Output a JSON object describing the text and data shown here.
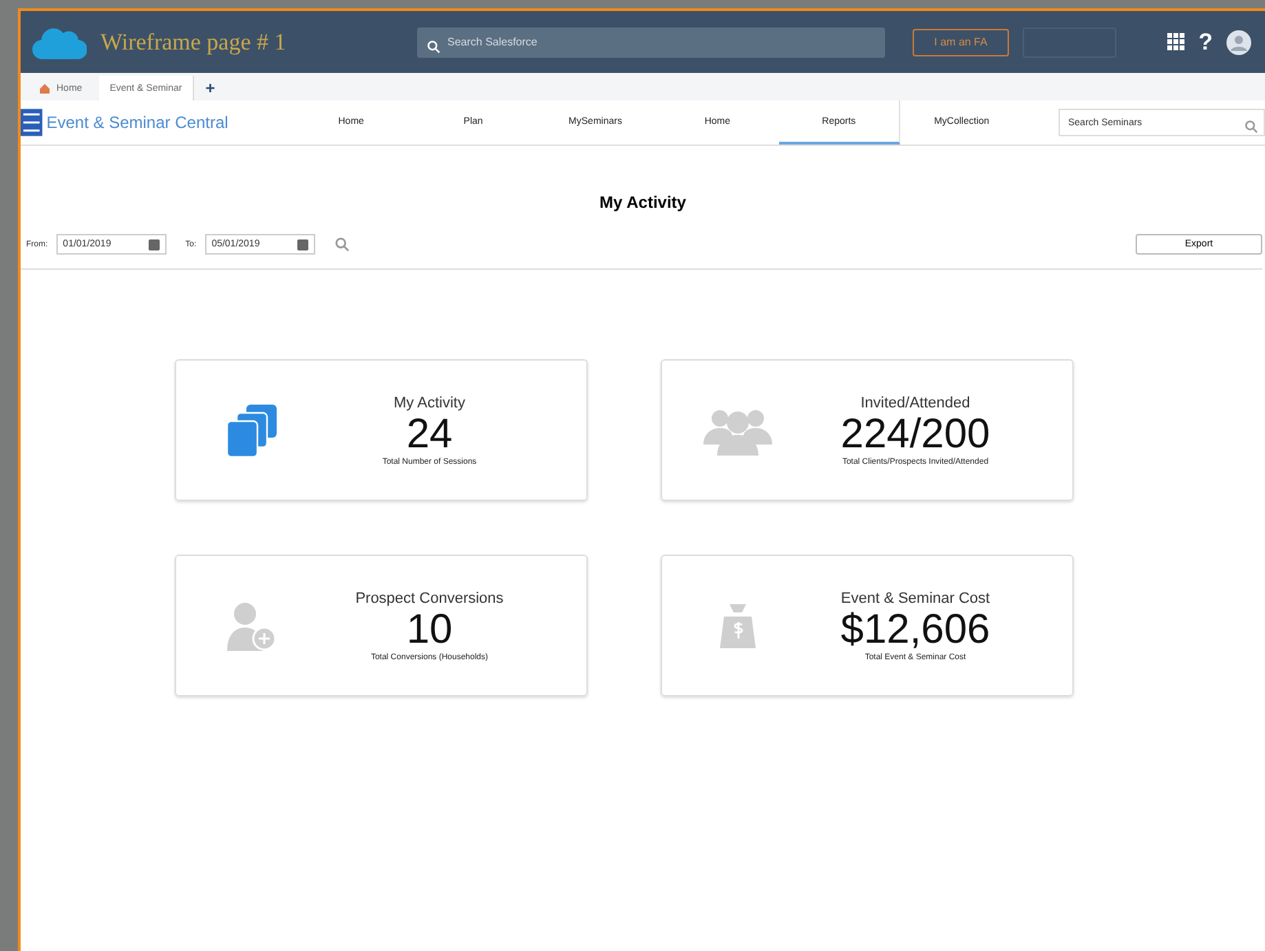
{
  "header": {
    "title": "Wireframe page # 1",
    "search": {
      "placeholder": "Search Salesforce"
    },
    "button": "I am an FA",
    "help": "?"
  },
  "tabs": [
    {
      "label": "Home",
      "selected": false,
      "kind": "home"
    },
    {
      "label": "Event & Seminar",
      "selected": true,
      "kind": "plain"
    }
  ],
  "add_tab": "+",
  "app": {
    "name": "Event & Seminar Central"
  },
  "nav": [
    {
      "label": "Home",
      "selected": false
    },
    {
      "label": "Plan",
      "selected": false
    },
    {
      "label": "MySeminars",
      "selected": false
    },
    {
      "label": "Home",
      "selected": false
    },
    {
      "label": "Reports",
      "selected": true
    },
    {
      "label": "MyCollection",
      "selected": false
    }
  ],
  "nav_search": {
    "placeholder": "Search Seminars"
  },
  "page_title": "My Activity",
  "filters": [
    {
      "label": "From:",
      "value": "01/01/2019"
    },
    {
      "label": "To:",
      "value": "05/01/2019"
    }
  ],
  "export": "Export",
  "cards": [
    {
      "kind": "sessions",
      "title": "My Activity",
      "value": "24",
      "caption": "Total Number of Sessions"
    },
    {
      "kind": "people",
      "title": "Invited/Attended",
      "value": "224/200",
      "caption": "Total Clients/Prospects Invited/Attended"
    },
    {
      "kind": "conversion",
      "title": "Prospect Conversions",
      "value": "10",
      "caption": "Total Conversions (Households)"
    },
    {
      "kind": "cost",
      "title": "Event & Seminar Cost",
      "value": "$12,606",
      "caption": "Total Event & Seminar Cost"
    }
  ]
}
